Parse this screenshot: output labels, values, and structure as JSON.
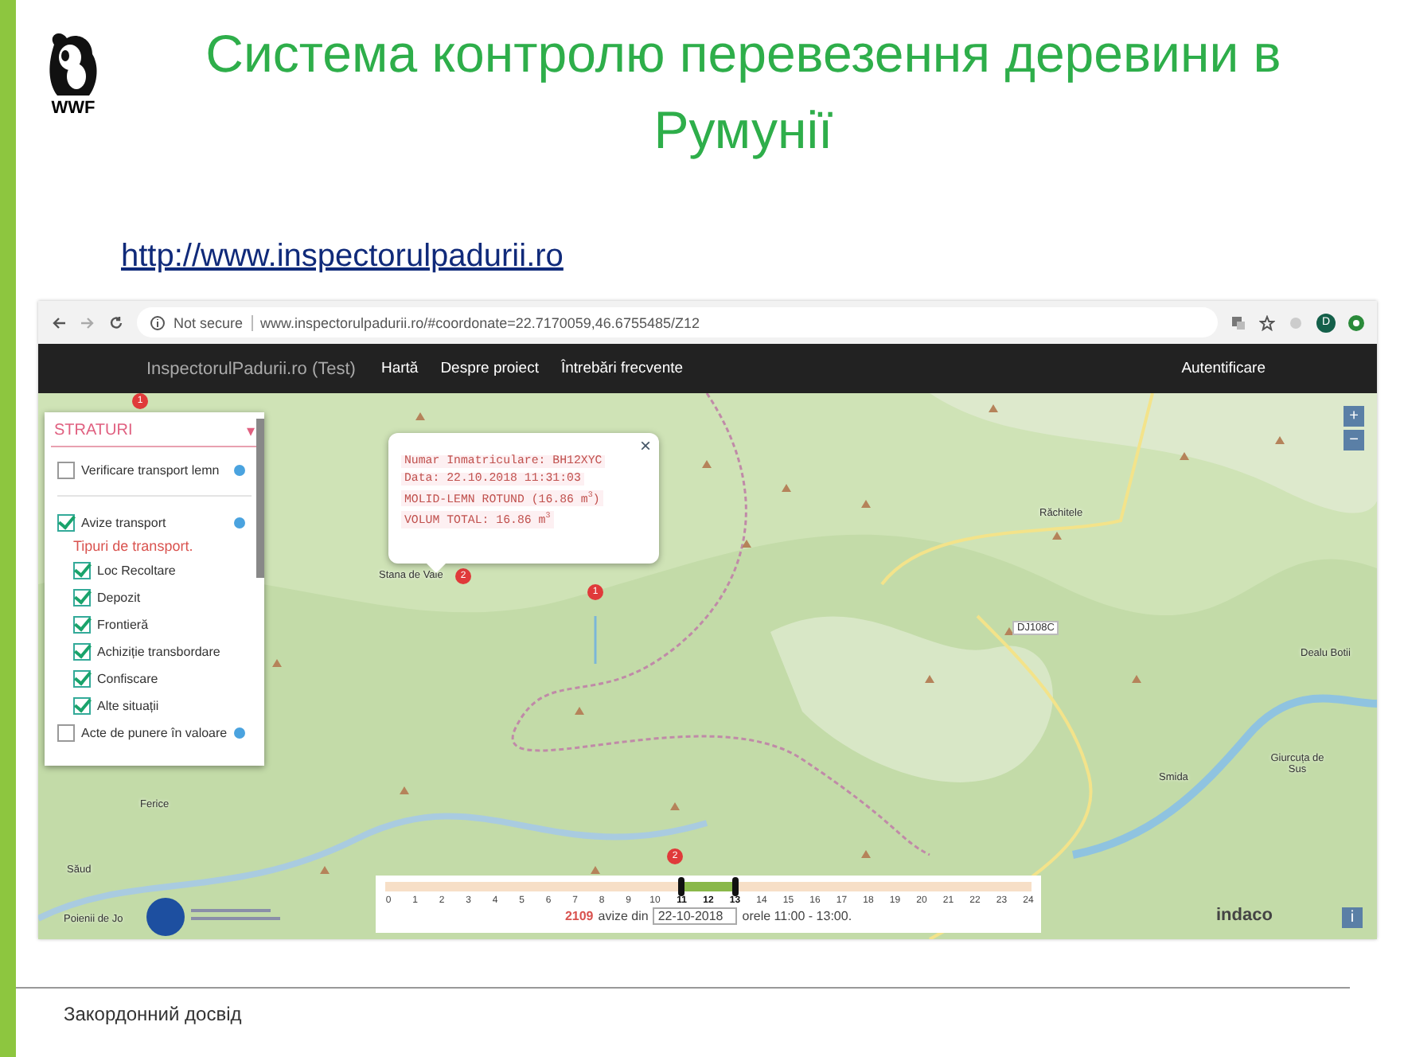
{
  "slide": {
    "logo_text": "WWF",
    "title": "Система контролю перевезення деревини в Румунії",
    "link": "http://www.inspectorulpadurii.ro",
    "footer": "Закордонний досвід"
  },
  "browser": {
    "security": "Not secure",
    "url": "www.inspectorulpadurii.ro/#coordonate=22.7170059,46.6755485/Z12",
    "profile_initial": "D"
  },
  "nav": {
    "brand": "InspectorulPadurii.ro (Test)",
    "links": [
      "Hartă",
      "Despre proiect",
      "Întrebări frecvente"
    ],
    "login": "Autentificare"
  },
  "layers": {
    "title": "STRATURI",
    "caret": "▾",
    "items": [
      {
        "label": "Verificare transport lemn",
        "checked": false
      },
      {
        "label": "Avize transport",
        "checked": true,
        "subheading": "Tipuri de transport.",
        "children": [
          {
            "label": "Loc Recoltare",
            "checked": true
          },
          {
            "label": "Depozit",
            "checked": true
          },
          {
            "label": "Frontieră",
            "checked": true
          },
          {
            "label": "Achiziție transbordare",
            "checked": true
          },
          {
            "label": "Confiscare",
            "checked": true
          },
          {
            "label": "Alte situații",
            "checked": true
          }
        ]
      },
      {
        "label": "Acte de punere în valoare",
        "checked": false
      }
    ]
  },
  "popup": {
    "close": "×",
    "lines": [
      "Numar Inmatriculare: BH12XYC",
      "Data: 22.10.2018 11:31:03",
      "MOLID-LEMN ROTUND (16.86 m$^{3}$)",
      "VOLUM TOTAL: 16.86 m$^{3}$"
    ]
  },
  "map": {
    "places": [
      "Stana de Vale",
      "Răchitele",
      "DJ108C",
      "Dealu Botii",
      "Smida",
      "Giurcuța de Sus",
      "Ferice",
      "Săud",
      "Poienii de Jo"
    ],
    "markers": [
      "1",
      "2",
      "1",
      "2"
    ],
    "zoom_in": "+",
    "zoom_out": "−",
    "info": "i",
    "partner": "indaco"
  },
  "timeline": {
    "ticks": [
      {
        "label": "0",
        "selected": false
      },
      {
        "label": "1",
        "selected": false
      },
      {
        "label": "2",
        "selected": false
      },
      {
        "label": "3",
        "selected": false
      },
      {
        "label": "4",
        "selected": false
      },
      {
        "label": "5",
        "selected": false
      },
      {
        "label": "6",
        "selected": false
      },
      {
        "label": "7",
        "selected": false
      },
      {
        "label": "8",
        "selected": false
      },
      {
        "label": "9",
        "selected": false
      },
      {
        "label": "10",
        "selected": false
      },
      {
        "label": "11",
        "selected": true
      },
      {
        "label": "12",
        "selected": true
      },
      {
        "label": "13",
        "selected": true
      },
      {
        "label": "14",
        "selected": false
      },
      {
        "label": "15",
        "selected": false
      },
      {
        "label": "16",
        "selected": false
      },
      {
        "label": "17",
        "selected": false
      },
      {
        "label": "18",
        "selected": false
      },
      {
        "label": "19",
        "selected": false
      },
      {
        "label": "20",
        "selected": false
      },
      {
        "label": "21",
        "selected": false
      },
      {
        "label": "22",
        "selected": false
      },
      {
        "label": "23",
        "selected": false
      },
      {
        "label": "24",
        "selected": false
      }
    ],
    "count": "2109",
    "count_text": "avize din",
    "date": "22-10-2018",
    "hours": "orele 11:00 - 13:00."
  }
}
